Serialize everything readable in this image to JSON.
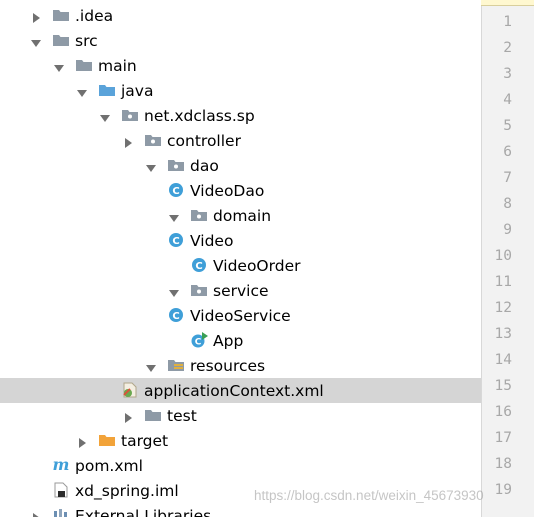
{
  "tree": {
    "rows": [
      {
        "label": ".idea",
        "icon": "folder-icon",
        "expanded": false
      },
      {
        "label": "src",
        "icon": "folder-icon",
        "expanded": true
      },
      {
        "label": "main",
        "icon": "folder-icon",
        "expanded": true
      },
      {
        "label": "java",
        "icon": "source-folder-icon",
        "expanded": true
      },
      {
        "label": "net.xdclass.sp",
        "icon": "package-icon",
        "expanded": true
      },
      {
        "label": "controller",
        "icon": "package-icon",
        "expanded": false
      },
      {
        "label": "dao",
        "icon": "package-icon",
        "expanded": true
      },
      {
        "label": "VideoDao",
        "icon": "class-icon"
      },
      {
        "label": "domain",
        "icon": "package-icon",
        "expanded": true
      },
      {
        "label": "Video",
        "icon": "class-icon"
      },
      {
        "label": "VideoOrder",
        "icon": "class-icon"
      },
      {
        "label": "service",
        "icon": "package-icon",
        "expanded": true
      },
      {
        "label": "VideoService",
        "icon": "class-icon"
      },
      {
        "label": "App",
        "icon": "main-class-icon"
      },
      {
        "label": "resources",
        "icon": "resources-folder-icon",
        "expanded": true
      },
      {
        "label": "applicationContext.xml",
        "icon": "spring-xml-icon",
        "selected": true
      },
      {
        "label": "test",
        "icon": "folder-icon",
        "expanded": false
      },
      {
        "label": "target",
        "icon": "excluded-folder-icon",
        "expanded": false
      },
      {
        "label": "pom.xml",
        "icon": "maven-icon"
      },
      {
        "label": "xd_spring.iml",
        "icon": "iml-file-icon"
      },
      {
        "label": "External Libraries",
        "icon": "libraries-icon",
        "expanded": false
      }
    ]
  },
  "gutter": {
    "line_numbers": [
      "1",
      "2",
      "3",
      "4",
      "5",
      "6",
      "7",
      "8",
      "9",
      "10",
      "11",
      "12",
      "13",
      "14",
      "15",
      "16",
      "17",
      "18",
      "19"
    ]
  },
  "watermark": "https://blog.csdn.net/weixin_45673930",
  "colors": {
    "folder": "#8e9aa6",
    "source_folder": "#5ba3d9",
    "excluded_folder": "#f2a33a",
    "class_badge": "#3f9fd8",
    "selection": "#d5d5d5",
    "arrow": "#707070"
  }
}
